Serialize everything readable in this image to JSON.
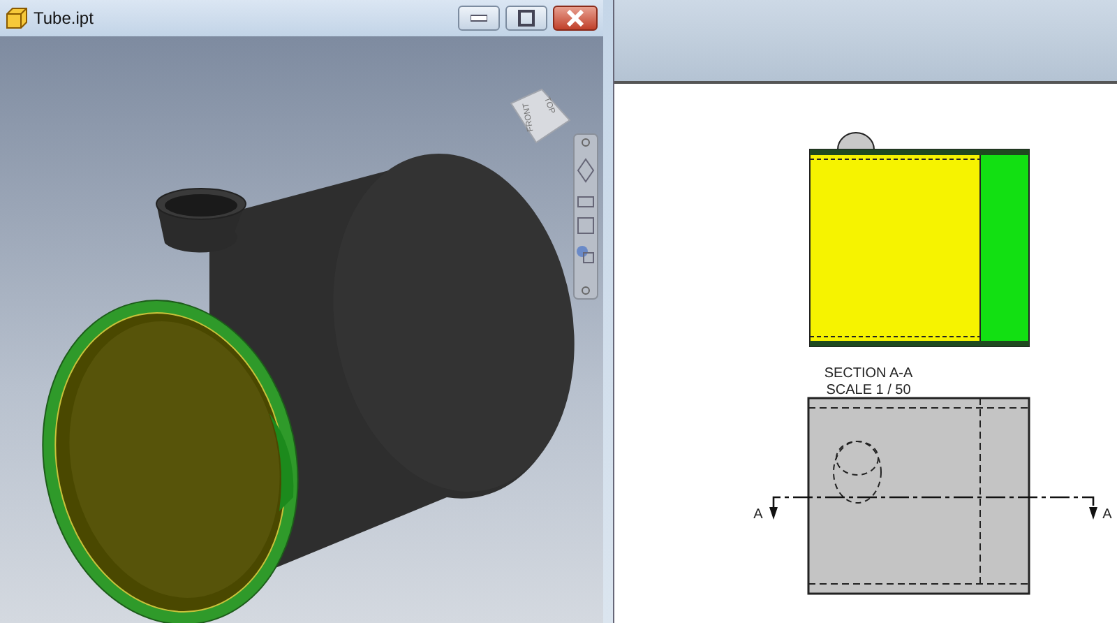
{
  "window": {
    "title": "Tube.ipt"
  },
  "viewcube": {
    "faces": [
      {
        "kind": "top",
        "label": "TOP"
      },
      {
        "kind": "front",
        "label": "FRONT"
      }
    ]
  },
  "drawing": {
    "section_view": {
      "title": "SECTION A-A",
      "scale": "SCALE 1 / 50"
    },
    "cutting_plane": {
      "labels": [
        "A",
        "A"
      ]
    }
  }
}
